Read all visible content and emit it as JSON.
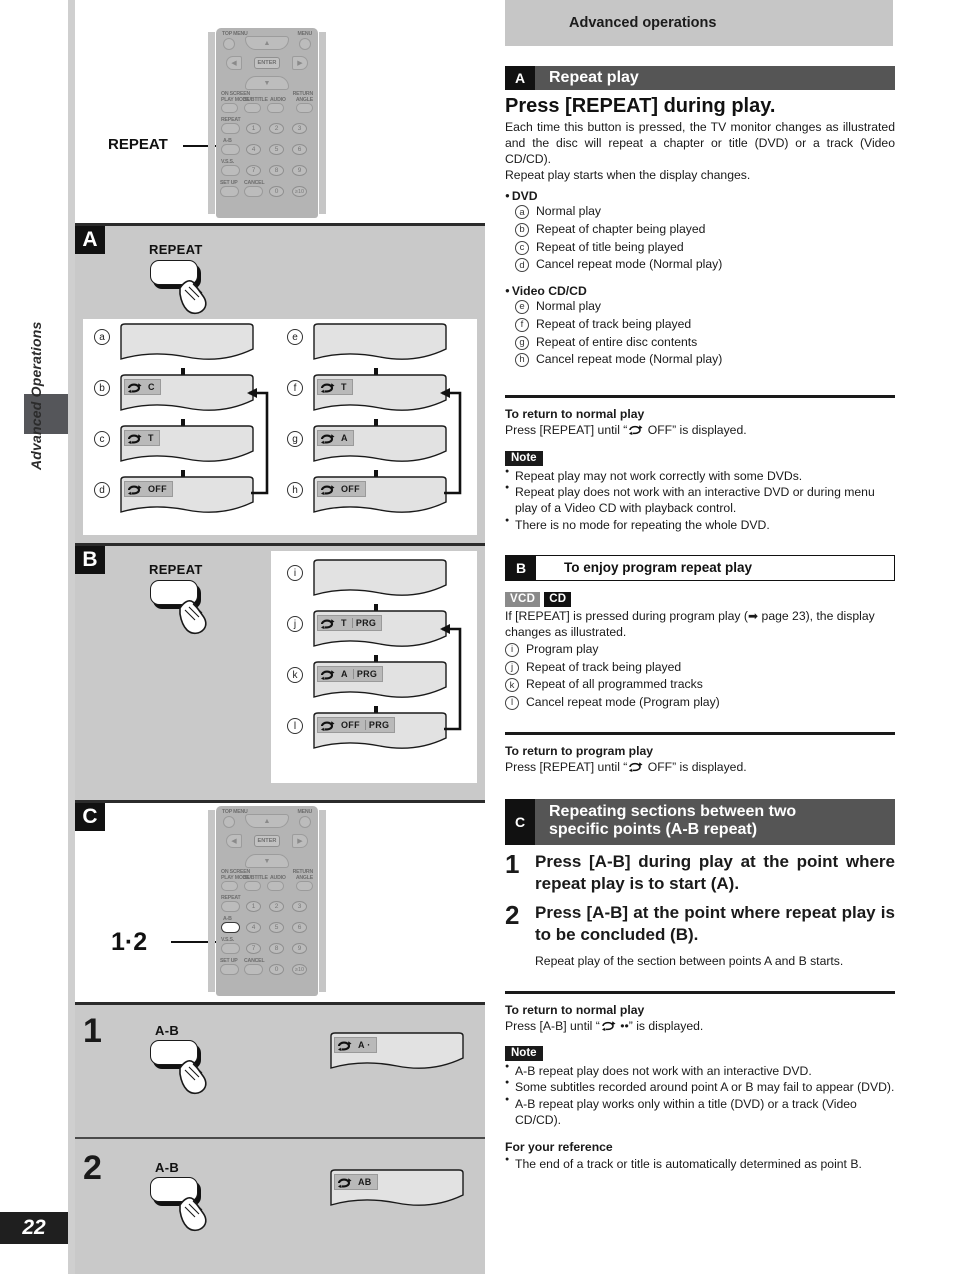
{
  "page": {
    "number": "22",
    "side_tab_label": "Advanced Operations"
  },
  "header": {
    "banner_title": "Advanced operations"
  },
  "left": {
    "callout_repeat": "REPEAT",
    "callout_12": "1·2",
    "btn_repeat_caption": "REPEAT",
    "btn_ab_caption": "A-B",
    "badge_a": "A",
    "badge_b": "B",
    "badge_c": "C",
    "step1": "1",
    "step2": "2",
    "remote": {
      "top_menu": "TOP MENU",
      "menu": "MENU",
      "enter": "ENTER",
      "on_screen": "ON SCREEN",
      "return": "RETURN",
      "play_mode": "PLAY MODE",
      "subtitle": "SUBTITLE",
      "audio": "AUDIO",
      "angle": "ANGLE",
      "repeat": "REPEAT",
      "ab": "A-B",
      "vss": "V.S.S.",
      "set_up": "SET UP",
      "cancel": "CANCEL",
      "keys": [
        "1",
        "2",
        "3",
        "4",
        "5",
        "6",
        "7",
        "8",
        "9",
        "0",
        "≥10"
      ],
      "up": "▲",
      "down": "▼",
      "left": "◀",
      "right": "▶"
    },
    "diagram_a_dvd": [
      {
        "mark": "a",
        "osd": "",
        "prg": ""
      },
      {
        "mark": "b",
        "osd": "C",
        "prg": ""
      },
      {
        "mark": "c",
        "osd": "T",
        "prg": ""
      },
      {
        "mark": "d",
        "osd": "OFF",
        "prg": ""
      }
    ],
    "diagram_a_vcd": [
      {
        "mark": "e",
        "osd": "",
        "prg": ""
      },
      {
        "mark": "f",
        "osd": "T",
        "prg": ""
      },
      {
        "mark": "g",
        "osd": "A",
        "prg": ""
      },
      {
        "mark": "h",
        "osd": "OFF",
        "prg": ""
      }
    ],
    "diagram_b": [
      {
        "mark": "i",
        "osd": "",
        "prg": ""
      },
      {
        "mark": "j",
        "osd": "T",
        "prg": "PRG"
      },
      {
        "mark": "k",
        "osd": "A",
        "prg": "PRG"
      },
      {
        "mark": "l",
        "osd": "OFF",
        "prg": "PRG"
      }
    ],
    "diagram_c": [
      {
        "step": "1",
        "osd": "A ·"
      },
      {
        "step": "2",
        "osd": "AB"
      }
    ]
  },
  "sections": {
    "a": {
      "badge": "A",
      "title": "Repeat play",
      "heading": "Press [REPEAT] during play.",
      "intro1": "Each time this button is pressed, the TV monitor changes as illustrated and the disc will repeat a chapter or title (DVD) or a track (Video CD/CD).",
      "intro2": "Repeat play starts when the display changes.",
      "dvd_label": "DVD",
      "dvd_items": [
        {
          "mark": "a",
          "text": "Normal play"
        },
        {
          "mark": "b",
          "text": "Repeat of chapter being played"
        },
        {
          "mark": "c",
          "text": "Repeat of title being played"
        },
        {
          "mark": "d",
          "text": "Cancel repeat mode (Normal play)"
        }
      ],
      "vcd_label": "Video CD/CD",
      "vcd_items": [
        {
          "mark": "e",
          "text": "Normal play"
        },
        {
          "mark": "f",
          "text": "Repeat of track being played"
        },
        {
          "mark": "g",
          "text": "Repeat of entire disc contents"
        },
        {
          "mark": "h",
          "text": "Cancel repeat mode (Normal play)"
        }
      ],
      "return_hd": "To return to normal play",
      "return_txt_before": "Press [REPEAT] until “",
      "return_txt_after": " OFF” is displayed.",
      "note_tag": "Note",
      "notes": [
        "Repeat play may not work correctly with some DVDs.",
        "Repeat play does not work with an interactive DVD or during menu play of a Video CD with playback control.",
        "There is no mode for repeating the whole DVD."
      ]
    },
    "b": {
      "badge": "B",
      "title": "To enjoy program repeat play",
      "tag_vcd": "VCD",
      "tag_cd": "CD",
      "intro": "If [REPEAT] is pressed during program play (➡ page 23), the display changes as illustrated.",
      "items": [
        {
          "mark": "i",
          "text": "Program play"
        },
        {
          "mark": "j",
          "text": "Repeat of track being played"
        },
        {
          "mark": "k",
          "text": "Repeat of all programmed tracks"
        },
        {
          "mark": "l",
          "text": "Cancel repeat mode (Program play)"
        }
      ],
      "return_hd": "To return to program play",
      "return_txt_before": "Press [REPEAT] until “",
      "return_txt_after": " OFF” is displayed."
    },
    "c": {
      "badge": "C",
      "title_l1": "Repeating sections between two",
      "title_l2": "specific points (A-B repeat)",
      "step1_num": "1",
      "step1_text": "Press [A-B] during play at the point where repeat play is to start (A).",
      "step2_num": "2",
      "step2_text": "Press [A-B] at the point where repeat play is to be concluded (B).",
      "step2_sub": "Repeat play of the section between points A and B starts.",
      "return_hd": "To return to normal play",
      "return_txt_before": "Press [A-B] until “",
      "return_txt_after": " ••” is displayed.",
      "note_tag": "Note",
      "notes": [
        "A-B repeat play does not work with an interactive DVD.",
        "Some subtitles recorded around point A or B may fail to appear (DVD).",
        "A-B repeat play works only within a title (DVD) or a track (Video CD/CD)."
      ],
      "ref_hd": "For your reference",
      "refs": [
        "The end of a track or title is automatically determined as point B."
      ]
    }
  }
}
